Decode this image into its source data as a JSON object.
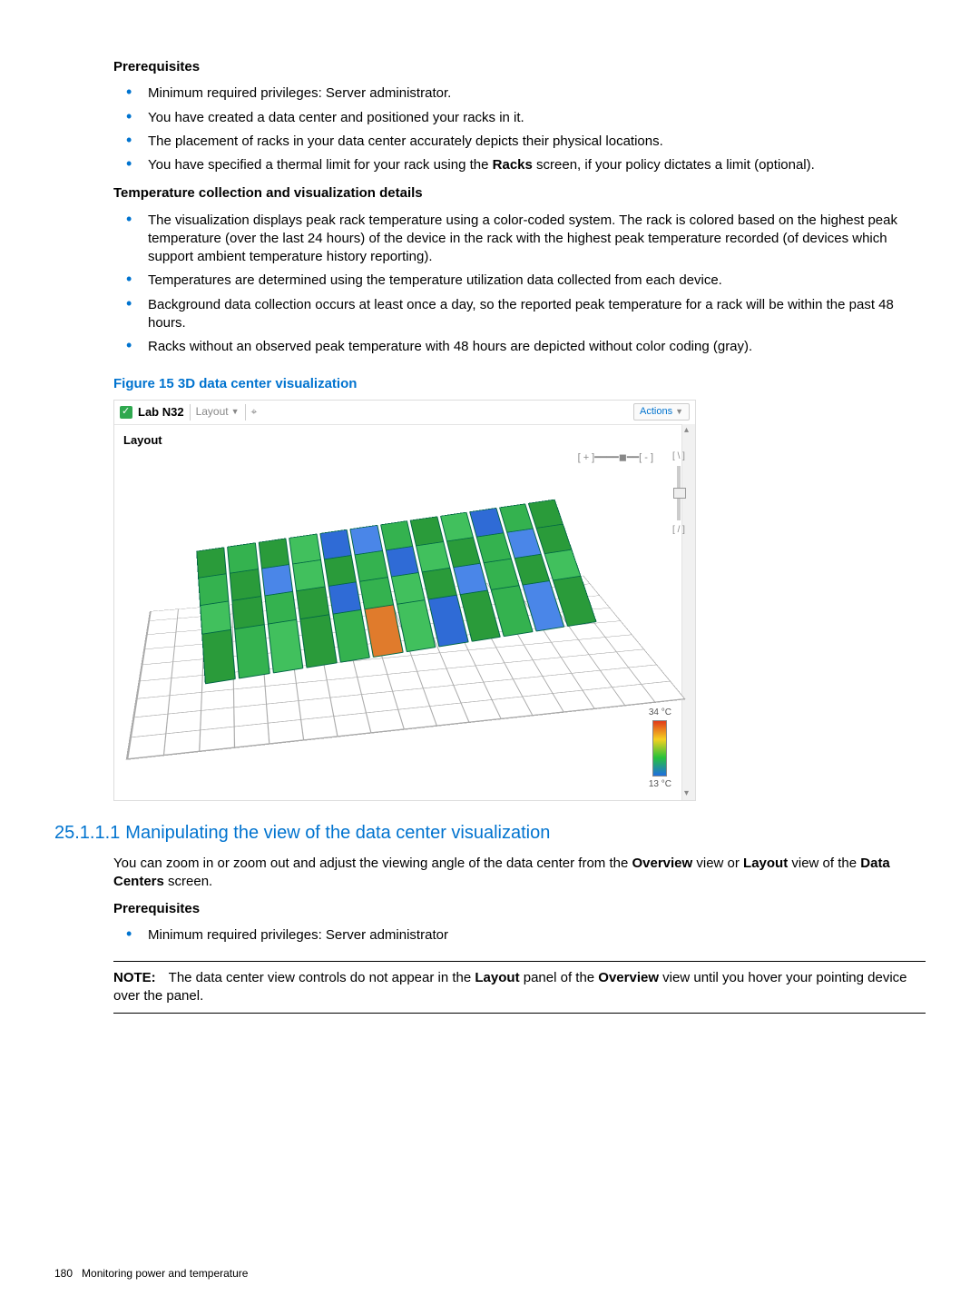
{
  "section1": {
    "prereq_heading": "Prerequisites",
    "prereq_items": [
      "Minimum required privileges: Server administrator.",
      "You have created a data center and positioned your racks in it.",
      "The placement of racks in your data center accurately depicts their physical locations.",
      "You have specified a thermal limit for your rack using the <b>Racks</b> screen, if your policy dictates a limit (optional)."
    ],
    "details_heading": "Temperature collection and visualization details",
    "details_items": [
      "The visualization displays peak rack temperature using a color-coded system. The rack is colored based on the highest peak temperature (over the last 24 hours) of the device in the rack with the highest peak temperature recorded (of devices which support ambient temperature history reporting).",
      "Temperatures are determined using the temperature utilization data collected from each device.",
      "Background data collection occurs at least once a day, so the reported peak temperature for a rack will be within the past 48 hours.",
      "Racks without an observed peak temperature with 48 hours are depicted without color coding (gray)."
    ]
  },
  "figure": {
    "caption": "Figure 15 3D data center visualization",
    "lab_name": "Lab N32",
    "view_label": "Layout",
    "actions_label": "Actions",
    "panel_title": "Layout",
    "hzoom_minus": "[ - ]",
    "hzoom_plus": "[ + ]",
    "vctrl_up": "[ \\ ]",
    "vctrl_down": "[ / ]",
    "legend_max": "34 °C",
    "legend_min": "13 °C"
  },
  "section2": {
    "number": "25.1.1.1",
    "title": "Manipulating the view of the data center visualization",
    "intro": "You can zoom in or zoom out and adjust the viewing angle of the data center from the <b>Overview</b> view or <b>Layout</b> view of the <b>Data Centers</b> screen.",
    "prereq_heading": "Prerequisites",
    "prereq_items": [
      "Minimum required privileges: Server administrator"
    ],
    "note_label": "NOTE:",
    "note_body": "The data center view controls do not appear in the <b>Layout</b> panel of the <b>Overview</b> view until you hover your pointing device over the panel."
  },
  "footer": {
    "page_number": "180",
    "chapter": "Monitoring power and temperature"
  }
}
